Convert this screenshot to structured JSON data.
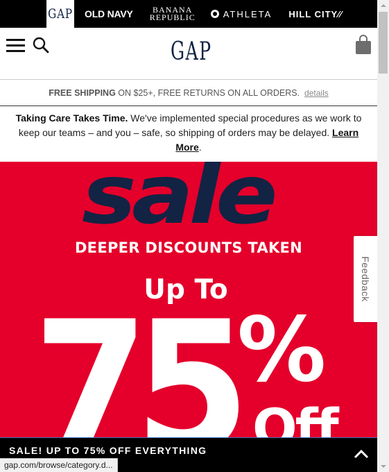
{
  "brands": {
    "gap": "GAP",
    "old_navy": "OLD NAVY",
    "banana_line1": "BANANA",
    "banana_line2": "REPUBLIC",
    "athleta": "ATHLETA",
    "hill_city": "HILL CITY⁄⁄"
  },
  "header": {
    "logo": "GAP"
  },
  "shipping": {
    "bold": "FREE SHIPPING",
    "rest": " ON $25+, FREE RETURNS ON ALL ORDERS.",
    "details": "details"
  },
  "notice": {
    "title": "Taking Care Takes Time.",
    "body": " We've implemented special procedures as we work to keep our teams – and you – safe, so shipping of orders may be delayed. ",
    "link": "Learn More",
    "end": "."
  },
  "hero": {
    "sale": "sale",
    "subtitle": "DEEPER DISCOUNTS TAKEN",
    "upto": "Up To",
    "number": "75",
    "percent": "%",
    "off": "Off"
  },
  "feedback": "Feedback",
  "promo": "SALE! UP TO 75% OFF EVERYTHING",
  "status_url": "gap.com/browse/category.d...",
  "colors": {
    "navy": "#122344",
    "sale_red": "#e4002b"
  }
}
